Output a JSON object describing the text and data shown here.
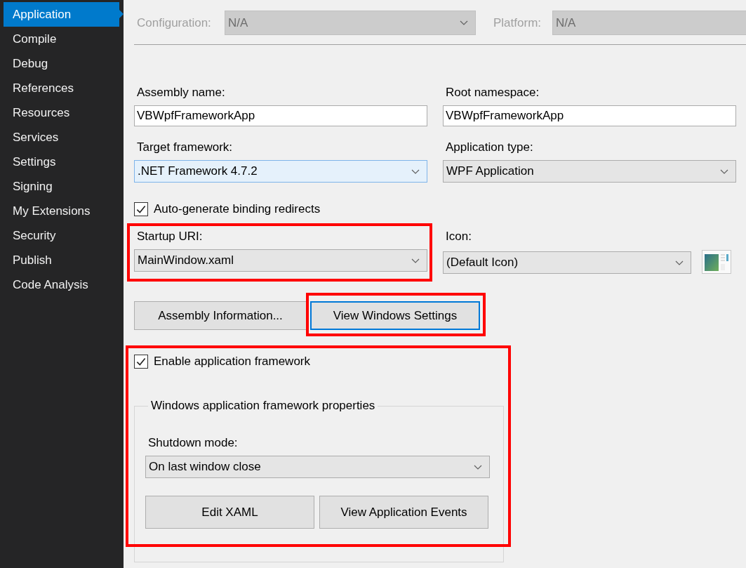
{
  "sidebar": {
    "items": [
      {
        "label": "Application",
        "selected": true
      },
      {
        "label": "Compile",
        "selected": false
      },
      {
        "label": "Debug",
        "selected": false
      },
      {
        "label": "References",
        "selected": false
      },
      {
        "label": "Resources",
        "selected": false
      },
      {
        "label": "Services",
        "selected": false
      },
      {
        "label": "Settings",
        "selected": false
      },
      {
        "label": "Signing",
        "selected": false
      },
      {
        "label": "My Extensions",
        "selected": false
      },
      {
        "label": "Security",
        "selected": false
      },
      {
        "label": "Publish",
        "selected": false
      },
      {
        "label": "Code Analysis",
        "selected": false
      }
    ]
  },
  "configuration": {
    "label": "Configuration:",
    "value": "N/A",
    "disabled": true
  },
  "platform": {
    "label": "Platform:",
    "value": "N/A",
    "disabled": true
  },
  "assembly_name": {
    "label": "Assembly name:",
    "value": "VBWpfFrameworkApp"
  },
  "root_namespace": {
    "label": "Root namespace:",
    "value": "VBWpfFrameworkApp"
  },
  "target_framework": {
    "label": "Target framework:",
    "value": ".NET Framework 4.7.2",
    "focused": true
  },
  "application_type": {
    "label": "Application type:",
    "value": "WPF Application",
    "focused": false
  },
  "binding_redirects": {
    "label": "Auto-generate binding redirects",
    "checked": true
  },
  "startup_uri": {
    "label": "Startup URI:",
    "value": "MainWindow.xaml",
    "highlighted": true
  },
  "icon": {
    "label": "Icon:",
    "value": "(Default Icon)"
  },
  "buttons": [
    {
      "label": "Assembly Information...",
      "focused": false,
      "highlighted": false
    },
    {
      "label": "View Windows Settings",
      "focused": true,
      "highlighted": true
    }
  ],
  "application_framework": {
    "highlighted": true,
    "label": "Enable application framework",
    "checked": true,
    "group_title": "Windows application framework properties",
    "shutdown_mode": {
      "label": "Shutdown mode:",
      "value": "On last window close"
    },
    "buttons": [
      {
        "label": "Edit XAML"
      },
      {
        "label": "View Application Events"
      }
    ]
  }
}
